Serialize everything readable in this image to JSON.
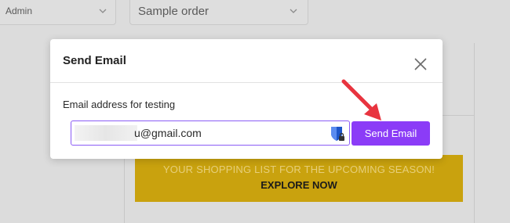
{
  "background": {
    "role_select_value": "Admin",
    "order_select_value": "Sample order",
    "banner": {
      "line1": "YOUR SHOPPING LIST FOR THE UPCOMING SEASON!",
      "line2": "EXPLORE NOW"
    }
  },
  "modal": {
    "title": "Send Email",
    "field_label": "Email address for testing",
    "email_value_visible": "u@gmail.com",
    "send_button_label": "Send Email",
    "accent_color": "#8b3cf7"
  },
  "icons": [
    "chevron-down-icon",
    "close-icon",
    "password-manager-icon",
    "red-arrow-annotation"
  ]
}
